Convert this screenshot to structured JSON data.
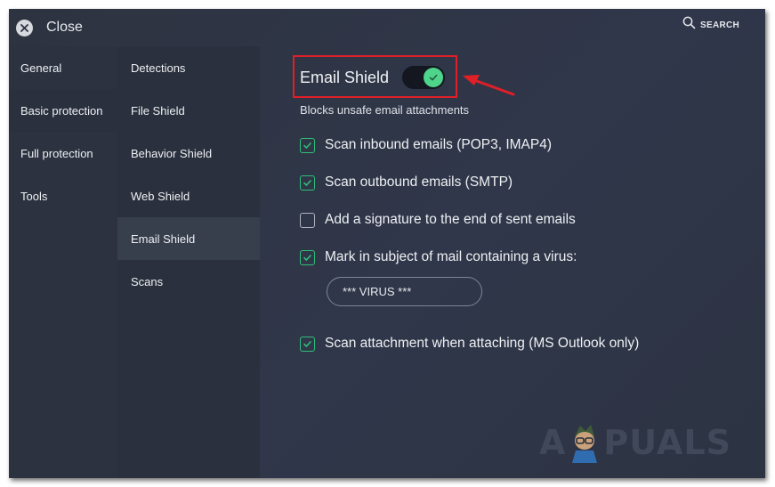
{
  "header": {
    "close_label": "Close",
    "close_icon": "close-icon",
    "search_label": "SEARCH",
    "search_icon": "search-icon"
  },
  "nav_primary": [
    {
      "label": "General",
      "active": false
    },
    {
      "label": "Basic protection",
      "active": true
    },
    {
      "label": "Full protection",
      "active": false
    },
    {
      "label": "Tools",
      "active": false
    }
  ],
  "nav_secondary": [
    {
      "label": "Detections",
      "active": false
    },
    {
      "label": "File Shield",
      "active": false
    },
    {
      "label": "Behavior Shield",
      "active": false
    },
    {
      "label": "Web Shield",
      "active": false
    },
    {
      "label": "Email Shield",
      "active": true
    },
    {
      "label": "Scans",
      "active": false
    }
  ],
  "content": {
    "title": "Email Shield",
    "enabled": true,
    "subtitle": "Blocks unsafe email attachments",
    "options": [
      {
        "label": "Scan inbound emails (POP3, IMAP4)",
        "checked": true
      },
      {
        "label": "Scan outbound emails (SMTP)",
        "checked": true
      },
      {
        "label": "Add a signature to the end of sent emails",
        "checked": false
      },
      {
        "label": "Mark in subject of mail containing a virus:",
        "checked": true
      },
      {
        "label": "Scan attachment when attaching (MS Outlook only)",
        "checked": true
      }
    ],
    "virus_subject_value": "*** VIRUS ***"
  },
  "watermark": {
    "letter_a": "A",
    "rest": "PUALS"
  },
  "colors": {
    "accent_green": "#4fd58b",
    "highlight_red": "#e01f27",
    "background": "#2d3340"
  }
}
